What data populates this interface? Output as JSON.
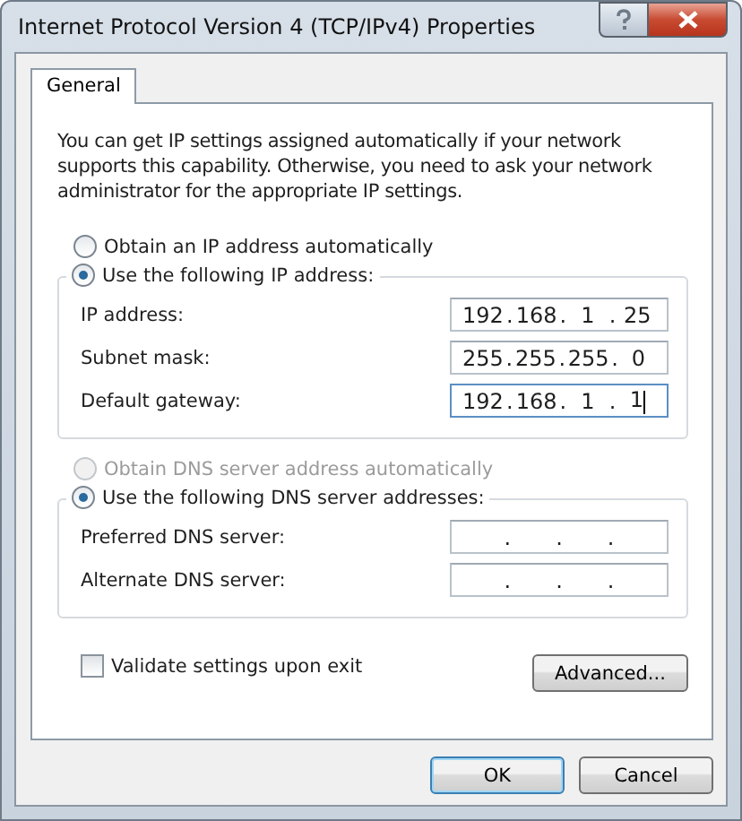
{
  "window": {
    "title": "Internet Protocol Version 4 (TCP/IPv4) Properties"
  },
  "tabs": [
    {
      "label": "General",
      "selected": true
    }
  ],
  "intro": "You can get IP settings assigned automatically if your network supports this capability. Otherwise, you need to ask your network administrator for the appropriate IP settings.",
  "ip_auto": {
    "label": "Obtain an IP address automatically",
    "selected": false,
    "disabled": false
  },
  "ip_manual": {
    "label": "Use the following IP address:",
    "selected": true,
    "disabled": false
  },
  "ip_fields": [
    {
      "label": "IP address:",
      "octets": [
        "192",
        "168",
        "1",
        "25"
      ],
      "dots": [
        ".",
        ".",
        "."
      ],
      "focused": false
    },
    {
      "label": "Subnet mask:",
      "octets": [
        "255",
        "255",
        "255",
        "0"
      ],
      "dots": [
        ".",
        ".",
        "."
      ],
      "focused": false
    },
    {
      "label": "Default gateway:",
      "octets": [
        "192",
        "168",
        "1",
        "1"
      ],
      "dots": [
        ".",
        ".",
        "."
      ],
      "focused": true
    }
  ],
  "dns_auto": {
    "label": "Obtain DNS server address automatically",
    "selected": false,
    "disabled": true
  },
  "dns_manual": {
    "label": "Use the following DNS server addresses:",
    "selected": true,
    "disabled": false
  },
  "dns_fields": [
    {
      "label": "Preferred DNS server:",
      "dots": [
        ".",
        ".",
        "."
      ],
      "focused": false
    },
    {
      "label": "Alternate DNS server:",
      "dots": [
        ".",
        ".",
        "."
      ],
      "focused": false
    }
  ],
  "validate": {
    "label": "Validate settings upon exit",
    "checked": false
  },
  "advanced_button": "Advanced...",
  "buttons": [
    "OK",
    "Cancel"
  ]
}
